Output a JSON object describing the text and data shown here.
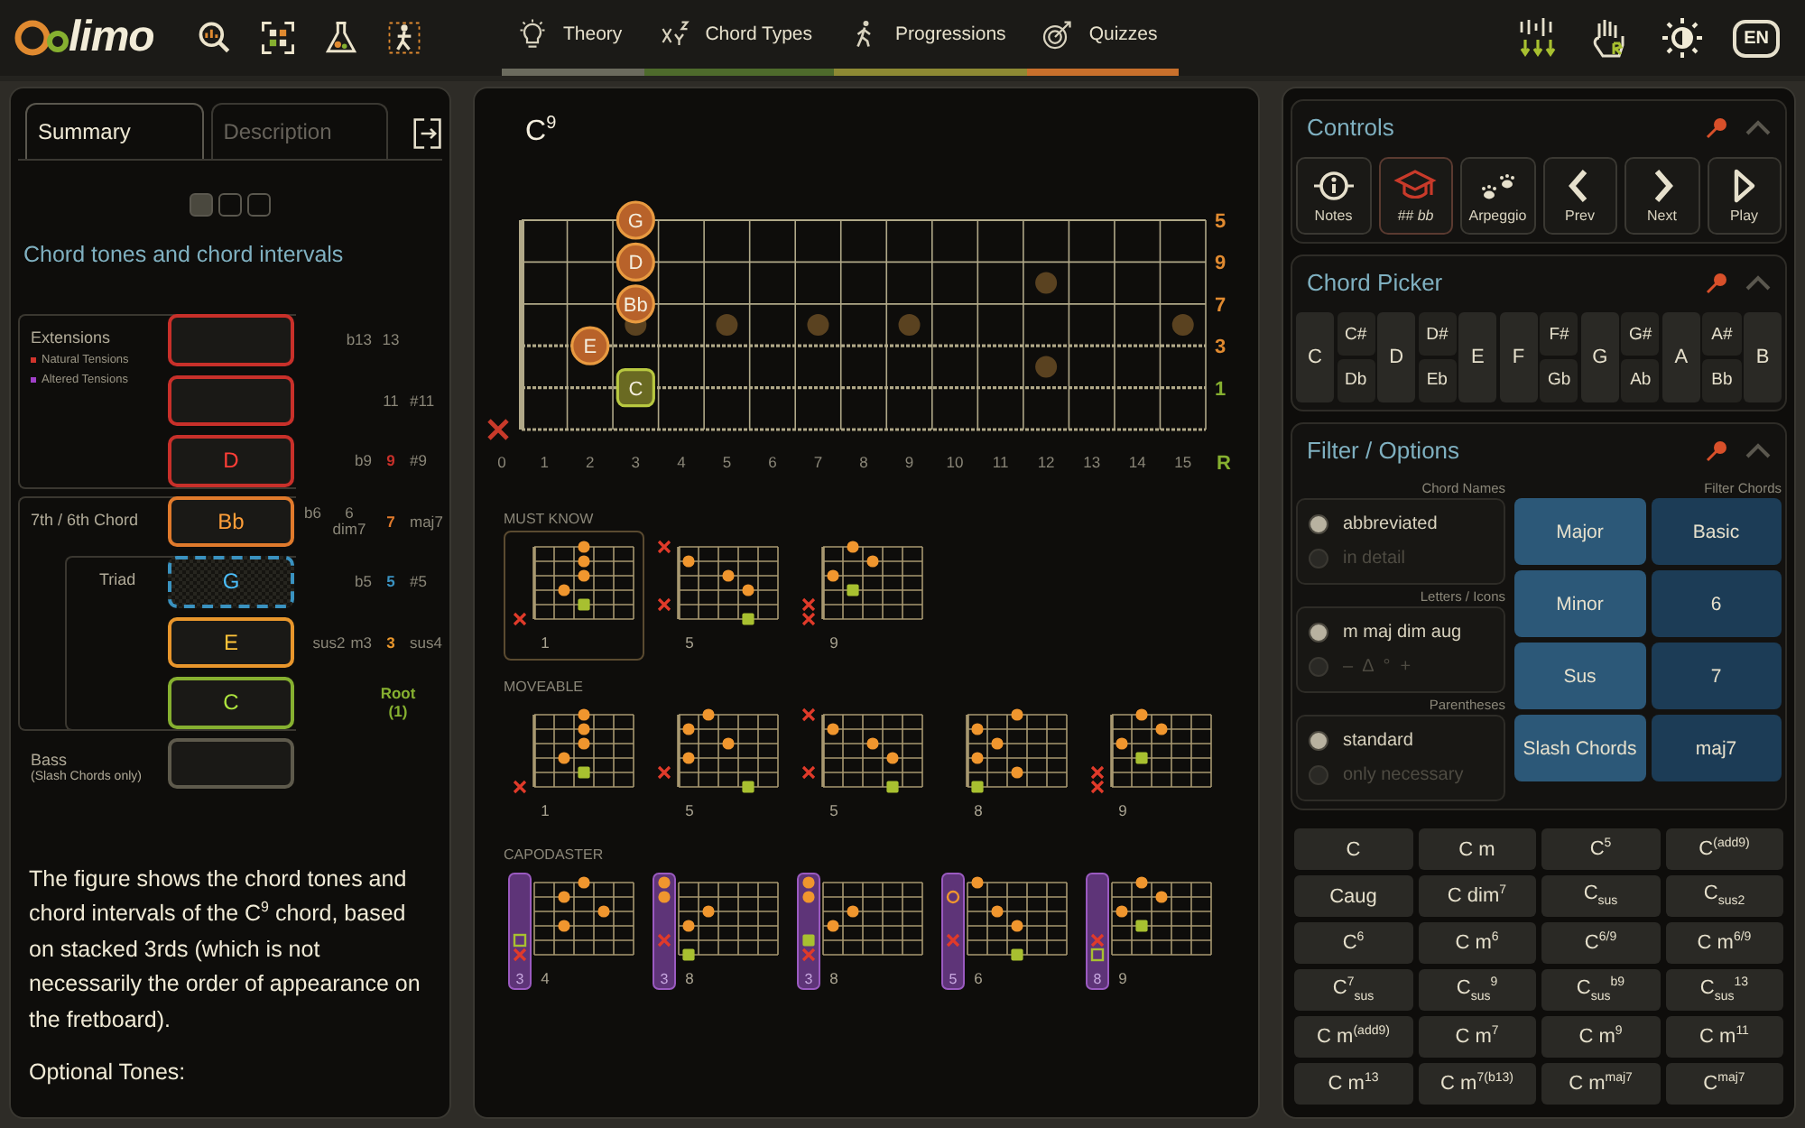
{
  "nav": {
    "logo": "limo",
    "tabs": [
      {
        "label": "Theory",
        "kind": "theory",
        "color": "#6b6b5e"
      },
      {
        "label": "Chord Types",
        "kind": "types",
        "color": "#4e6b2c"
      },
      {
        "label": "Progressions",
        "kind": "progressions",
        "color": "#8e8a34"
      },
      {
        "label": "Quizzes",
        "kind": "quizzes",
        "color": "#c8702c"
      }
    ],
    "language": "EN"
  },
  "left": {
    "tabs": [
      {
        "label": "Summary",
        "selected": true
      },
      {
        "label": "Description",
        "selected": false
      }
    ],
    "pager": [
      {
        "selected": true
      },
      {
        "selected": false
      },
      {
        "selected": false
      }
    ],
    "heading": "Chord tones and chord intervals",
    "groups": [
      {
        "kind": "extensions",
        "label": "Extensions",
        "legend": [
          {
            "label": "Natural Tensions",
            "color": "#d0342c"
          },
          {
            "label": "Altered Tensions",
            "color": "#a040c8"
          }
        ]
      },
      {
        "kind": "seventh",
        "label": "7th / 6th Chord"
      },
      {
        "kind": "triad",
        "label": "Triad"
      },
      {
        "kind": "bass",
        "label": "Bass",
        "note": "(Slash Chords only)"
      }
    ],
    "tones": [
      {
        "color": "#c8302a",
        "dashed": false,
        "before": [
          "b13"
        ],
        "main": {
          "text": "13",
          "active": false
        }
      },
      {
        "color": "#c8302a",
        "dashed": false,
        "main": {
          "text": "11",
          "active": false
        },
        "after": [
          "#11"
        ]
      },
      {
        "note": "D",
        "color": "#c8302a",
        "dashed": false,
        "before": [
          "b9"
        ],
        "main": {
          "text": "9",
          "active": true
        },
        "after": [
          "#9"
        ]
      },
      {
        "note": "Bb",
        "color": "#e07a2c",
        "dashed": false,
        "before": [
          "b6",
          "6 dim7"
        ],
        "main": {
          "text": "7",
          "active": true
        },
        "after": [
          "maj7"
        ]
      },
      {
        "note": "G",
        "color": "#3a92c0",
        "dashed": true,
        "before": [
          "b5"
        ],
        "main": {
          "text": "5",
          "active": true
        },
        "after": [
          "#5"
        ]
      },
      {
        "note": "E",
        "color": "#e8962c",
        "dashed": false,
        "before": [
          "sus2",
          "m3"
        ],
        "main": {
          "text": "3",
          "active": true
        },
        "after": [
          "sus4"
        ]
      },
      {
        "note": "C",
        "color": "#86b030",
        "dashed": false,
        "main": {
          "text": "Root (1)",
          "active": true
        }
      },
      {
        "color": "#5e5a4c",
        "dashed": false
      }
    ],
    "text": "The figure shows the chord tones and chord intervals of the C$^{9}$ chord, based on stacked 3rds (which is not necessarily the order of appearance on the fretboard).",
    "subheading": "Optional Tones:"
  },
  "middle": {
    "chord": "C$^{9}$",
    "strings": [
      {
        "label": "5",
        "kind": "tone",
        "note": {
          "label": "G",
          "kind": "tone",
          "at": [
            false,
            false,
            false,
            true
          ]
        }
      },
      {
        "label": "9",
        "kind": "tone",
        "note": {
          "label": "D",
          "kind": "tone",
          "at": [
            false,
            false,
            false,
            true
          ]
        }
      },
      {
        "label": "7",
        "kind": "tone",
        "note": {
          "label": "Bb",
          "kind": "tone",
          "at": [
            false,
            false,
            false,
            true
          ]
        }
      },
      {
        "label": "3",
        "kind": "tone",
        "note": {
          "label": "E",
          "kind": "tone",
          "at": [
            false,
            false,
            true
          ]
        }
      },
      {
        "label": "1",
        "kind": "root",
        "note": {
          "label": "C",
          "kind": "root",
          "at": [
            false,
            false,
            false,
            true
          ]
        }
      },
      {
        "kind": "muted"
      }
    ],
    "frets": [
      "0",
      "1",
      "2",
      "3",
      "4",
      "5",
      "6",
      "7",
      "8",
      "9",
      "10",
      "11",
      "12",
      "13",
      "14",
      "15"
    ],
    "root_label": "R",
    "sections": [
      {
        "title": "MUST KNOW",
        "diagrams": [
          {
            "fret": "1",
            "selected": true,
            "rows": [
              {
                "kind": "tone",
                "at": [
                  false,
                  false,
                  true
                ]
              },
              {
                "kind": "tone",
                "at": [
                  false,
                  false,
                  true
                ]
              },
              {
                "kind": "tone",
                "at": [
                  false,
                  false,
                  true
                ]
              },
              {
                "kind": "tone",
                "at": [
                  false,
                  true
                ]
              },
              {
                "kind": "root",
                "at": [
                  false,
                  false,
                  true
                ]
              },
              {
                "kind": "mute"
              }
            ]
          },
          {
            "fret": "5",
            "selected": false,
            "rows": [
              {
                "kind": "mute"
              },
              {
                "kind": "tone",
                "at": [
                  true
                ]
              },
              {
                "kind": "tone",
                "at": [
                  false,
                  false,
                  true
                ]
              },
              {
                "kind": "tone",
                "at": [
                  false,
                  false,
                  false,
                  true
                ]
              },
              {
                "kind": "mute"
              },
              {
                "kind": "root",
                "at": [
                  false,
                  false,
                  false,
                  true
                ]
              }
            ]
          },
          {
            "fret": "9",
            "selected": false,
            "rows": [
              {
                "kind": "tone",
                "at": [
                  false,
                  true
                ]
              },
              {
                "kind": "tone",
                "at": [
                  false,
                  false,
                  true
                ]
              },
              {
                "kind": "tone",
                "at": [
                  true
                ]
              },
              {
                "kind": "root",
                "at": [
                  false,
                  true
                ]
              },
              {
                "kind": "mute"
              },
              {
                "kind": "mute"
              }
            ]
          }
        ]
      },
      {
        "title": "MOVEABLE",
        "diagrams": [
          {
            "fret": "1",
            "selected": false,
            "rows": [
              {
                "kind": "tone",
                "at": [
                  false,
                  false,
                  true
                ]
              },
              {
                "kind": "tone",
                "at": [
                  false,
                  false,
                  true
                ]
              },
              {
                "kind": "tone",
                "at": [
                  false,
                  false,
                  true
                ]
              },
              {
                "kind": "tone",
                "at": [
                  false,
                  true
                ]
              },
              {
                "kind": "root",
                "at": [
                  false,
                  false,
                  true
                ]
              },
              {
                "kind": "mute"
              }
            ]
          },
          {
            "fret": "5",
            "selected": false,
            "rows": [
              {
                "kind": "tone",
                "at": [
                  false,
                  true
                ]
              },
              {
                "kind": "tone",
                "at": [
                  true
                ]
              },
              {
                "kind": "tone",
                "at": [
                  false,
                  false,
                  true
                ]
              },
              {
                "kind": "tone",
                "at": [
                  true
                ]
              },
              {
                "kind": "mute"
              },
              {
                "kind": "root",
                "at": [
                  false,
                  false,
                  false,
                  true
                ]
              }
            ]
          },
          {
            "fret": "5",
            "selected": false,
            "rows": [
              {
                "kind": "mute"
              },
              {
                "kind": "tone",
                "at": [
                  true
                ]
              },
              {
                "kind": "tone",
                "at": [
                  false,
                  false,
                  true
                ]
              },
              {
                "kind": "tone",
                "at": [
                  false,
                  false,
                  false,
                  true
                ]
              },
              {
                "kind": "mute"
              },
              {
                "kind": "root",
                "at": [
                  false,
                  false,
                  false,
                  true
                ]
              }
            ]
          },
          {
            "fret": "8",
            "selected": false,
            "rows": [
              {
                "kind": "tone",
                "at": [
                  false,
                  false,
                  true
                ]
              },
              {
                "kind": "tone",
                "at": [
                  true
                ]
              },
              {
                "kind": "tone",
                "at": [
                  false,
                  true
                ]
              },
              {
                "kind": "tone",
                "at": [
                  true
                ]
              },
              {
                "kind": "tone",
                "at": [
                  false,
                  false,
                  true
                ]
              },
              {
                "kind": "root",
                "at": [
                  true
                ]
              }
            ]
          },
          {
            "fret": "9",
            "selected": false,
            "rows": [
              {
                "kind": "tone",
                "at": [
                  false,
                  true
                ]
              },
              {
                "kind": "tone",
                "at": [
                  false,
                  false,
                  true
                ]
              },
              {
                "kind": "tone",
                "at": [
                  true
                ]
              },
              {
                "kind": "root",
                "at": [
                  false,
                  true
                ]
              },
              {
                "kind": "mute"
              },
              {
                "kind": "mute"
              }
            ]
          }
        ]
      },
      {
        "title": "CAPODASTER",
        "diagrams": [
          {
            "capo": "3",
            "fret": "4",
            "selected": false,
            "rows": [
              {
                "kind": "tone",
                "at": [
                  false,
                  false,
                  true
                ]
              },
              {
                "kind": "tone",
                "at": [
                  false,
                  true
                ]
              },
              {
                "kind": "tone",
                "at": [
                  false,
                  false,
                  false,
                  true
                ]
              },
              {
                "kind": "tone",
                "at": [
                  false,
                  true
                ]
              },
              {
                "kind": "open_root"
              },
              {
                "kind": "mute"
              }
            ]
          },
          {
            "capo": "3",
            "fret": "8",
            "selected": false,
            "rows": [
              {
                "kind": "capo"
              },
              {
                "kind": "capo"
              },
              {
                "kind": "tone",
                "at": [
                  false,
                  true
                ]
              },
              {
                "kind": "tone",
                "at": [
                  true
                ]
              },
              {
                "kind": "mute"
              },
              {
                "kind": "root",
                "at": [
                  true
                ]
              }
            ]
          },
          {
            "capo": "3",
            "fret": "8",
            "selected": false,
            "rows": [
              {
                "kind": "capo"
              },
              {
                "kind": "capo"
              },
              {
                "kind": "tone",
                "at": [
                  false,
                  true
                ]
              },
              {
                "kind": "tone",
                "at": [
                  true
                ]
              },
              {
                "kind": "capo_root"
              },
              {
                "kind": "mute"
              }
            ]
          },
          {
            "capo": "5",
            "fret": "6",
            "selected": false,
            "rows": [
              {
                "kind": "tone",
                "at": [
                  true
                ]
              },
              {
                "kind": "open"
              },
              {
                "kind": "tone",
                "at": [
                  false,
                  true
                ]
              },
              {
                "kind": "tone",
                "at": [
                  false,
                  false,
                  true
                ]
              },
              {
                "kind": "mute"
              },
              {
                "kind": "root",
                "at": [
                  false,
                  false,
                  true
                ]
              }
            ]
          },
          {
            "capo": "8",
            "fret": "9",
            "selected": false,
            "rows": [
              {
                "kind": "tone",
                "at": [
                  false,
                  true
                ]
              },
              {
                "kind": "tone",
                "at": [
                  false,
                  false,
                  true
                ]
              },
              {
                "kind": "tone",
                "at": [
                  true
                ]
              },
              {
                "kind": "root",
                "at": [
                  false,
                  true
                ]
              },
              {
                "kind": "mute"
              },
              {
                "kind": "open_root"
              }
            ]
          }
        ]
      }
    ]
  },
  "right": {
    "controls": {
      "title": "Controls",
      "buttons": [
        {
          "kind": "notes",
          "label": "Notes",
          "on": false
        },
        {
          "kind": "accidentals",
          "label": "## bb",
          "on": true
        },
        {
          "kind": "arpeggio",
          "label": "Arpeggio",
          "on": false
        },
        {
          "kind": "prev",
          "label": "Prev",
          "on": false
        },
        {
          "kind": "next",
          "label": "Next",
          "on": false
        },
        {
          "kind": "play",
          "label": "Play",
          "on": false
        }
      ]
    },
    "picker": {
      "title": "Chord Picker",
      "keys": [
        {
          "kind": "natural",
          "label": "C"
        },
        {
          "kind": "accidental",
          "labels": [
            "C#",
            "Db"
          ]
        },
        {
          "kind": "natural",
          "label": "D"
        },
        {
          "kind": "accidental",
          "labels": [
            "D#",
            "Eb"
          ]
        },
        {
          "kind": "natural",
          "label": "E"
        },
        {
          "kind": "natural",
          "label": "F"
        },
        {
          "kind": "accidental",
          "labels": [
            "F#",
            "Gb"
          ]
        },
        {
          "kind": "natural",
          "label": "G"
        },
        {
          "kind": "accidental",
          "labels": [
            "G#",
            "Ab"
          ]
        },
        {
          "kind": "natural",
          "label": "A"
        },
        {
          "kind": "accidental",
          "labels": [
            "A#",
            "Bb"
          ]
        },
        {
          "kind": "natural",
          "label": "B"
        }
      ]
    },
    "filter": {
      "title": "Filter / Options",
      "groups": [
        {
          "title": "Chord Names",
          "options": [
            {
              "label": "abbreviated",
              "selected": true
            },
            {
              "label": "in detail",
              "selected": false
            }
          ]
        },
        {
          "title": "Letters / Icons",
          "options": [
            {
              "label": "m maj dim aug",
              "selected": true
            },
            {
              "label": "–  Δ  °  +",
              "selected": false
            }
          ]
        },
        {
          "title": "Parentheses",
          "options": [
            {
              "label": "standard",
              "selected": true
            },
            {
              "label": "only necessary",
              "selected": false
            }
          ]
        }
      ],
      "filter_title": "Filter Chords",
      "types": [
        "Major",
        "Minor",
        "Sus",
        "Slash Chords"
      ],
      "extensions": [
        "Basic",
        "6",
        "7",
        "maj7"
      ]
    },
    "chords": [
      "C",
      "C m",
      "C$^{5}$",
      "C$^{(add9)}$",
      "Caug",
      "C dim$^{7}$",
      "C$_{sus}$",
      "C$_{sus2}$",
      "C$^{6}$",
      "C m$^{6}$",
      "C$^{6/9}$",
      "C m$^{6/9}$",
      "C$^{7}$$_{sus}$",
      "C$_{sus}$$^{9}$",
      "C$_{sus}$$^{b9}$",
      "C$_{sus}$$^{13}$",
      "C m$^{(add9)}$",
      "C m$^{7}$",
      "C m$^{9}$",
      "C m$^{11}$",
      "C m$^{13}$",
      "C m$^{7(b13)}$",
      "C m$^{maj7}$",
      "C$^{maj7}$"
    ]
  }
}
